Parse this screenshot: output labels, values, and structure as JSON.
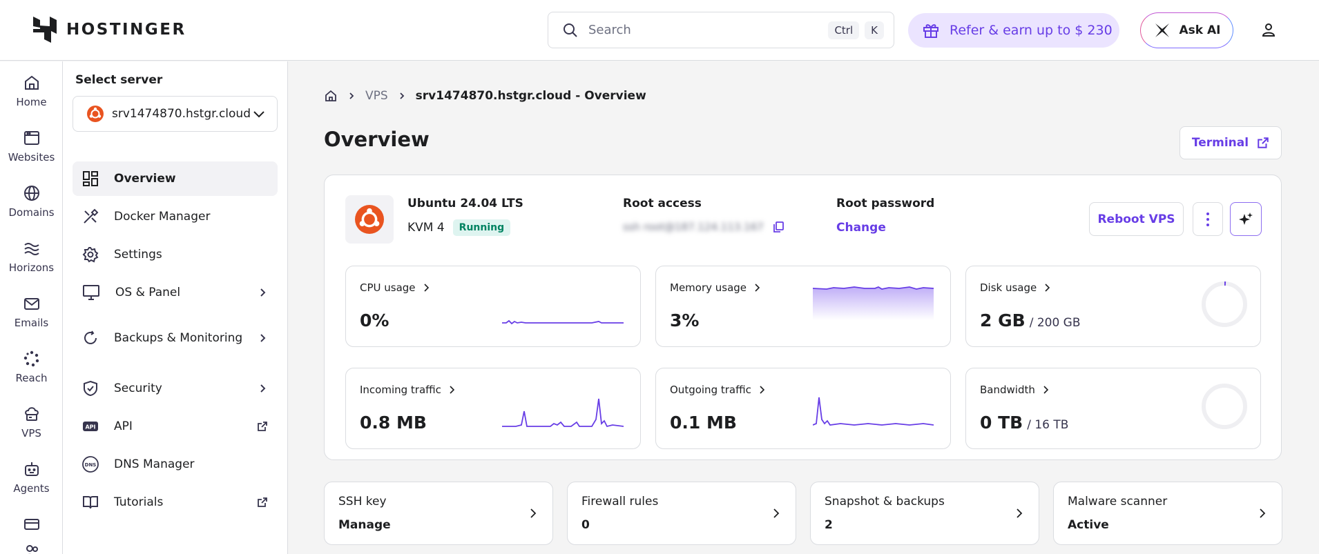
{
  "app": {
    "brand": "HOSTINGER",
    "accent": "#673de6"
  },
  "header": {
    "search_placeholder": "Search",
    "shortcut_keys": [
      "Ctrl",
      "K"
    ],
    "refer_label": "Refer & earn up to $ 230",
    "ask_ai_label": "Ask AI"
  },
  "sidebar": {
    "items": [
      {
        "label": "Home",
        "icon": "home-icon"
      },
      {
        "label": "Websites",
        "icon": "browser-window-icon"
      },
      {
        "label": "Domains",
        "icon": "globe-icon"
      },
      {
        "label": "Horizons",
        "icon": "horizons-icon"
      },
      {
        "label": "Emails",
        "icon": "envelope-icon"
      },
      {
        "label": "Reach",
        "icon": "reach-icon"
      },
      {
        "label": "VPS",
        "icon": "vps-cloud-icon"
      },
      {
        "label": "Agents",
        "icon": "robot-icon"
      }
    ]
  },
  "server_panel": {
    "title": "Select server",
    "selected_server": "srv1474870.hstgr.cloud",
    "menu": [
      {
        "label": "Overview",
        "icon": "dashboard-icon",
        "active": true
      },
      {
        "label": "Docker Manager",
        "icon": "tools-icon"
      },
      {
        "label": "Settings",
        "icon": "gear-icon"
      },
      {
        "label": "OS & Panel",
        "icon": "monitor-icon",
        "chevron": true
      },
      {
        "label": "Backups & Monitoring",
        "icon": "refresh-icon",
        "chevron": true
      },
      {
        "label": "Security",
        "icon": "shield-icon",
        "chevron": true
      },
      {
        "label": "API",
        "icon": "api-icon",
        "external": true
      },
      {
        "label": "DNS Manager",
        "icon": "dns-icon"
      },
      {
        "label": "Tutorials",
        "icon": "book-icon",
        "external": true
      }
    ]
  },
  "breadcrumb": {
    "section": "VPS",
    "current": "srv1474870.hstgr.cloud - Overview"
  },
  "page": {
    "title": "Overview",
    "terminal_label": "Terminal"
  },
  "server": {
    "os": "Ubuntu 24.04 LTS",
    "plan": "KVM 4",
    "status": "Running",
    "root_access_label": "Root access",
    "root_access_value": "ssh root@187.124.113.167",
    "root_password_label": "Root password",
    "change_label": "Change",
    "reboot_label": "Reboot VPS"
  },
  "metrics": [
    {
      "label": "CPU usage",
      "value": "0%"
    },
    {
      "label": "Memory usage",
      "value": "3%"
    },
    {
      "label": "Disk usage",
      "value": "2 GB",
      "total": "/ 200 GB",
      "fraction": 0.01
    },
    {
      "label": "Incoming traffic",
      "value": "0.8 MB"
    },
    {
      "label": "Outgoing traffic",
      "value": "0.1 MB"
    },
    {
      "label": "Bandwidth",
      "value": "0 TB",
      "total": "/ 16 TB",
      "fraction": 0
    }
  ],
  "quick_cards": [
    {
      "title": "SSH key",
      "value": "Manage"
    },
    {
      "title": "Firewall rules",
      "value": "0"
    },
    {
      "title": "Snapshot & backups",
      "value": "2"
    },
    {
      "title": "Malware scanner",
      "value": "Active"
    }
  ]
}
